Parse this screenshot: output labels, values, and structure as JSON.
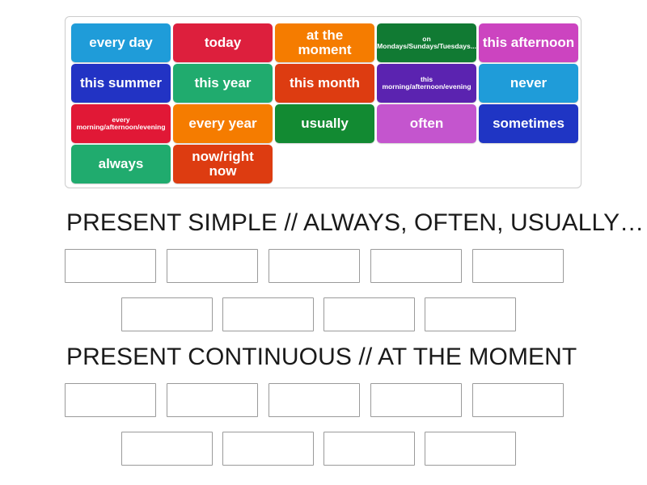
{
  "word_bank": {
    "rows": [
      [
        {
          "label": "every day",
          "color": "#1f9cd9",
          "size": "lg"
        },
        {
          "label": "today",
          "color": "#dd1f3d",
          "size": "lg"
        },
        {
          "label": "at the moment",
          "color": "#f57c00",
          "size": "lg"
        },
        {
          "label": "on Mondays/Sundays/Tuesdays...",
          "color": "#117a33",
          "size": "sm"
        },
        {
          "label": "this afternoon",
          "color": "#cc44c0",
          "size": "lg"
        }
      ],
      [
        {
          "label": "this summer",
          "color": "#2233c4",
          "size": "lg"
        },
        {
          "label": "this year",
          "color": "#20ab6e",
          "size": "lg"
        },
        {
          "label": "this month",
          "color": "#dd3c11",
          "size": "lg"
        },
        {
          "label": "this morning/afternoon/evening",
          "color": "#5b23b0",
          "size": "sm"
        },
        {
          "label": "never",
          "color": "#1f9cd9",
          "size": "lg"
        }
      ],
      [
        {
          "label": "every morning/afternoon/evening",
          "color": "#e11836",
          "size": "sm"
        },
        {
          "label": "every year",
          "color": "#f57c00",
          "size": "lg"
        },
        {
          "label": "usually",
          "color": "#128a32",
          "size": "lg"
        },
        {
          "label": "often",
          "color": "#c455ce",
          "size": "lg"
        },
        {
          "label": "sometimes",
          "color": "#1f35c4",
          "size": "lg"
        }
      ],
      [
        {
          "label": "always",
          "color": "#20ab6e",
          "size": "lg"
        },
        {
          "label": "now/right now",
          "color": "#dd3c11",
          "size": "lg"
        }
      ]
    ]
  },
  "sections": [
    {
      "title": "PRESENT SIMPLE // ALWAYS, OFTEN, USUALLY…",
      "drop_rows": [
        5,
        4
      ]
    },
    {
      "title": "PRESENT CONTINUOUS // AT THE MOMENT",
      "drop_rows": [
        5,
        4
      ]
    }
  ],
  "colors": {
    "background": "#ffffff",
    "bank_border": "#cccccc",
    "dropzone_border": "#9a9a9a",
    "heading_text": "#1a1a1a"
  }
}
